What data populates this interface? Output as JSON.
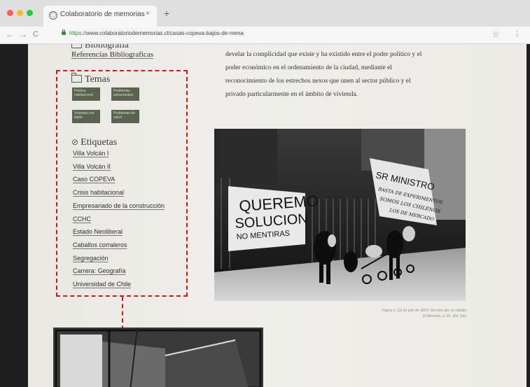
{
  "browser": {
    "tab_title": "Colaboratorio de memorias",
    "tab_close": "×",
    "new_tab": "+",
    "url_proto": "https://",
    "url_rest": "www.colaboratoriodememorias.cl/casas-copeva-bajos-de-mena",
    "back": "←",
    "forward": "→",
    "reload": "C",
    "star": "☆",
    "menu": "⋮"
  },
  "sidebar": {
    "biblio_heading": "Bibliografía",
    "biblio_link": "Referencias Bibliograficas",
    "themes_heading": "Temas",
    "themes": [
      {
        "label": "Política habitacional"
      },
      {
        "label": "Problemas estructurales"
      },
      {
        "label": "Vivienda con tejido"
      },
      {
        "label": "Problemas de salud"
      }
    ],
    "tags_heading": "Etiquetas",
    "tags": [
      "Villa Volcán I",
      "Villa Volcán II",
      "Caso COPEVA",
      "Crisis habitacional",
      "Empresariado de la construcción",
      "CCHC",
      "Estado Neoliberal",
      "Caballos corraleros",
      "Segregación",
      "Carrera: Geografía",
      "Universidad de Chile"
    ]
  },
  "article": {
    "paragraph_lines": [
      "develar la complicidad que existe y ha existido entre el poder político y el",
      "poder económico en el ordenamiento de la ciudad, mediante el",
      "reconocimiento de los estrechos nexos que unen al sector público y el",
      "privado particularmente en el ámbito de vivienda."
    ],
    "banner_left": [
      "QUEREMO",
      "SOLUCION",
      "NO MENTIRAS"
    ],
    "banner_right": [
      "SR MINISTRO",
      "BASTA DE EXPERIMENTOS",
      "SOMOS LOS CHILENOS",
      "LOS DE MERCADO"
    ],
    "caption_lines": [
      "Figura n. (22 de julio de 1997). Mi reino por un caballo",
      "El Mercurio, p. D1. Del. Dez"
    ]
  }
}
